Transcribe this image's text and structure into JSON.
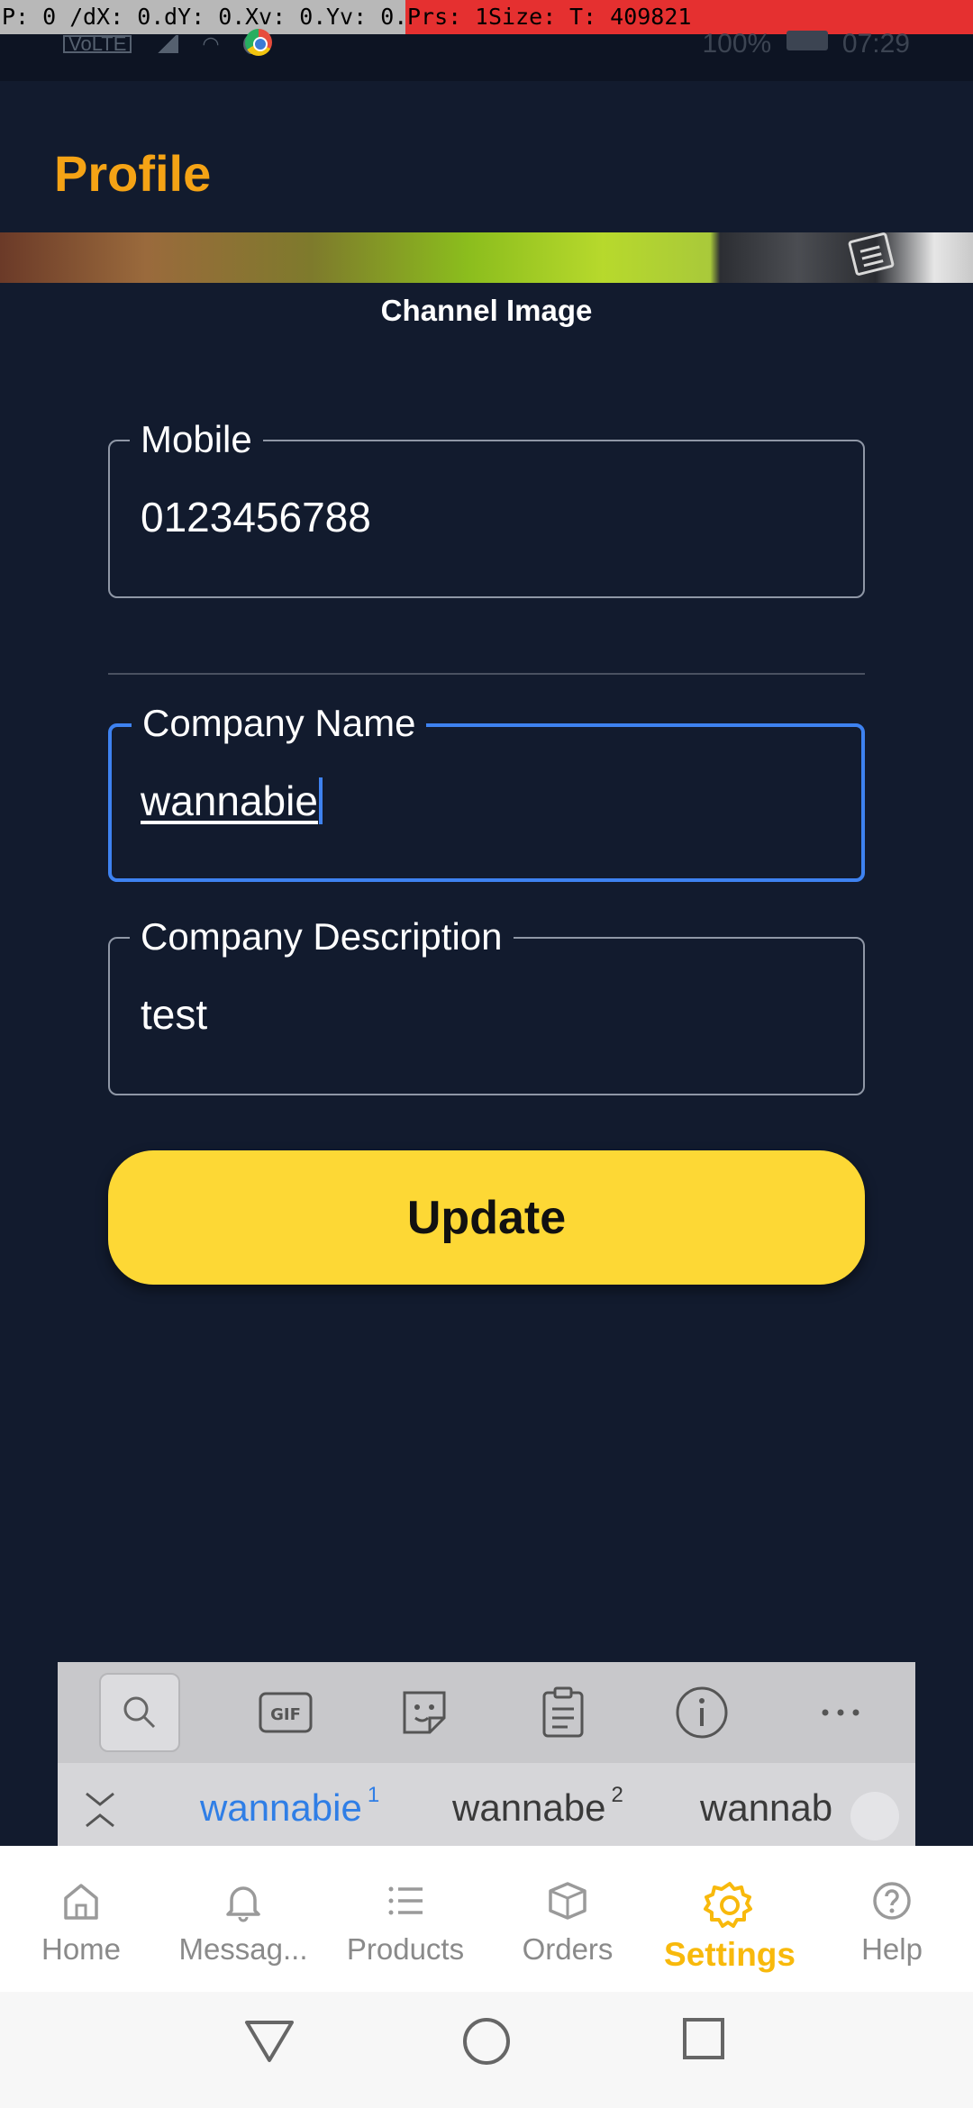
{
  "debug": {
    "p": "P: 0 / 1",
    "dx": "dX: 0.0",
    "dy": "dY: 0.0",
    "xv": "Xv: 0.0",
    "yv": "Yv: 0.0",
    "prs": "Prs: 1.0",
    "size": "Size: 1.0",
    "t": "T: 409821"
  },
  "status_bar": {
    "battery": "100%",
    "time": "07:29",
    "icons": [
      "volte-icon",
      "signal-icon",
      "wifi-icon",
      "alarm-icon",
      "chrome-icon"
    ]
  },
  "page": {
    "title": "Profile"
  },
  "channel": {
    "label": "Channel Image"
  },
  "form": {
    "mobile": {
      "label": "Mobile",
      "value": "0123456788"
    },
    "company_name": {
      "label": "Company Name",
      "value": "wannabie"
    },
    "company_description": {
      "label": "Company Description",
      "value": "test"
    },
    "update_label": "Update"
  },
  "keyboard": {
    "toolbar": [
      "search-icon",
      "gif-icon",
      "sticker-icon",
      "clipboard-icon",
      "info-icon",
      "more-icon"
    ],
    "suggestions": [
      {
        "word": "wannabie",
        "num": "1"
      },
      {
        "word": "wannabe",
        "num": "2"
      },
      {
        "word": "wannab"
      }
    ]
  },
  "nav": {
    "items": [
      {
        "label": "Home",
        "icon": "home-icon"
      },
      {
        "label": "Messag...",
        "icon": "bell-icon"
      },
      {
        "label": "Products",
        "icon": "list-icon"
      },
      {
        "label": "Orders",
        "icon": "box-icon"
      },
      {
        "label": "Settings",
        "icon": "gear-icon"
      },
      {
        "label": "Help",
        "icon": "help-icon"
      }
    ],
    "active": "Settings"
  },
  "colors": {
    "background": "#121b2e",
    "accent_title": "#f5a315",
    "button": "#fdd835",
    "focus": "#3e82f0",
    "nav_active": "#f8b90c"
  }
}
